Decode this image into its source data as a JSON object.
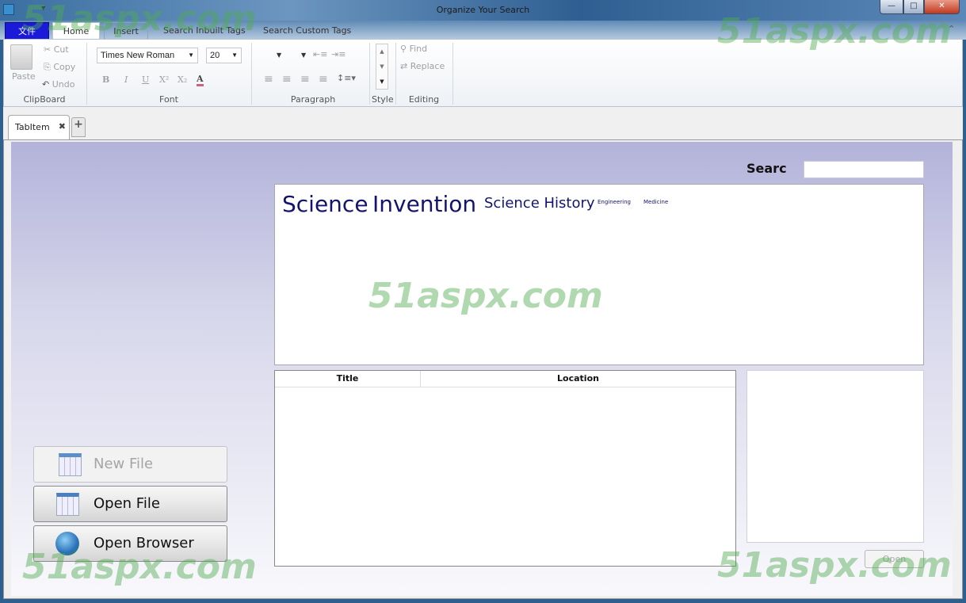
{
  "window": {
    "title": "Organize Your Search",
    "minimize": "—",
    "maximize": "□",
    "close": "✕"
  },
  "ribbon": {
    "tabs": [
      {
        "label": "文件"
      },
      {
        "label": "Home"
      },
      {
        "label": "Insert"
      },
      {
        "label": "Search Inbuilt Tags"
      },
      {
        "label": "Search Custom Tags"
      }
    ],
    "active_tab": "Home",
    "clipboard": {
      "paste": "Paste",
      "cut": "Cut",
      "copy": "Copy",
      "undo": "Undo",
      "group": "ClipBoard"
    },
    "font": {
      "family": "Times New Roman",
      "size": "20",
      "bold": "B",
      "italic": "I",
      "underline": "U",
      "superscript": "X²",
      "subscript": "X₂",
      "color": "A",
      "group": "Font"
    },
    "paragraph": {
      "group": "Paragraph"
    },
    "style": {
      "group": "Style"
    },
    "editing": {
      "find": "Find",
      "replace": "Replace",
      "group": "Editing"
    }
  },
  "doc_tabs": [
    {
      "label": "TabItem"
    }
  ],
  "add_tab": "+",
  "search": {
    "label": "Searc",
    "value": ""
  },
  "tag_cloud": [
    {
      "label": "Science",
      "size": "large"
    },
    {
      "label": "Invention",
      "size": "large"
    },
    {
      "label": "Science History",
      "size": "medium"
    },
    {
      "label": "Engineering",
      "size": "small"
    },
    {
      "label": "Medicine",
      "size": "small"
    }
  ],
  "results_table": {
    "columns": [
      "Title",
      "Location"
    ],
    "rows": []
  },
  "preview": {
    "open_button": "Open"
  },
  "actions": {
    "new_file": "New File",
    "open_file": "Open File",
    "open_browser": "Open Browser"
  },
  "watermark": "51aspx.com",
  "colors": {
    "tag_text": "#14146e",
    "content_bg_top": "#b3b3da",
    "file_tab": "#1a1ad8"
  }
}
